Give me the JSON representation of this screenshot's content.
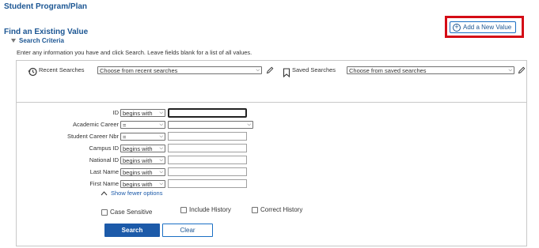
{
  "page": {
    "title": "Student Program/Plan"
  },
  "header": {
    "add_button_label": "Add a New Value",
    "add_icon": "plus-circle-icon"
  },
  "find": {
    "title": "Find an Existing Value",
    "criteria_label": "Search Criteria",
    "instructions": "Enter any information you have and click Search. Leave fields blank for a list of all values."
  },
  "searches": {
    "recent_label": "Recent Searches",
    "recent_placeholder": "Choose from recent searches",
    "saved_label": "Saved Searches",
    "saved_placeholder": "Choose from saved searches"
  },
  "fields": [
    {
      "label": "ID",
      "operator": "begins with",
      "value": ""
    },
    {
      "label": "Academic Career",
      "operator": "=",
      "value": ""
    },
    {
      "label": "Student Career Nbr",
      "operator": "=",
      "value": ""
    },
    {
      "label": "Campus ID",
      "operator": "begins with",
      "value": ""
    },
    {
      "label": "National ID",
      "operator": "begins with",
      "value": ""
    },
    {
      "label": "Last Name",
      "operator": "begins with",
      "value": ""
    },
    {
      "label": "First Name",
      "operator": "begins with",
      "value": ""
    }
  ],
  "options": {
    "show_fewer": "Show fewer options",
    "case_sensitive": "Case Sensitive",
    "include_history": "Include History",
    "correct_history": "Correct History"
  },
  "actions": {
    "search": "Search",
    "clear": "Clear"
  },
  "colors": {
    "accent": "#1c5693",
    "highlight_border": "#d40c16",
    "button_blue": "#1c5aa9"
  }
}
